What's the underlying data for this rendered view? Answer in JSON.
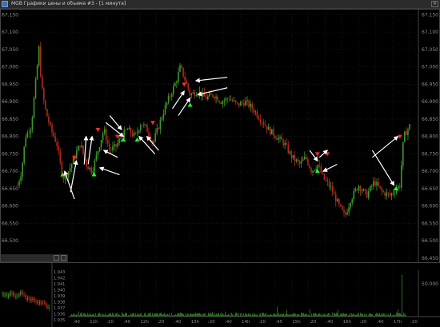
{
  "window": {
    "title": "MGB Графики цены и объема #3 - [1 минута]",
    "close_glyph": "×",
    "icon": "chart-window-icon"
  },
  "colors": {
    "background": "#000000",
    "grid": "#1e1e1e",
    "up_candle": "#3c9a2a",
    "down_candle": "#b02a1e",
    "buy_marker": "#22ff22",
    "sell_marker": "#ff2a2a",
    "annotation_arrow": "#ffffff",
    "axis_text": "#8c8c8c",
    "volume": "#3c9a2a"
  },
  "chart_data": [
    {
      "type": "candlestick",
      "title": "",
      "ylim": [
        66.45,
        67.16
      ],
      "y_ticks": [
        "67.150",
        "67.100",
        "67.050",
        "67.000",
        "66.950",
        "66.900",
        "66.850",
        "66.800",
        "66.750",
        "66.700",
        "66.650",
        "66.600",
        "66.550",
        "66.500",
        "66.450"
      ],
      "x_ticks": [
        ":40",
        "11h",
        ":20",
        ":40",
        "12h",
        ":20",
        ":40",
        "13h",
        ":20",
        ":40",
        "14h",
        ":20",
        ":45",
        "15h",
        ":20",
        ":40",
        "16h",
        ":20",
        ":40",
        "17h",
        ":20"
      ],
      "grid": true,
      "path": [
        {
          "t": 0.0,
          "p": 66.66
        },
        {
          "t": 0.01,
          "p": 66.7
        },
        {
          "t": 0.02,
          "p": 66.8
        },
        {
          "t": 0.035,
          "p": 66.83
        },
        {
          "t": 0.05,
          "p": 67.0
        },
        {
          "t": 0.055,
          "p": 67.06
        },
        {
          "t": 0.06,
          "p": 66.95
        },
        {
          "t": 0.07,
          "p": 66.88
        },
        {
          "t": 0.085,
          "p": 66.82
        },
        {
          "t": 0.1,
          "p": 66.78
        },
        {
          "t": 0.115,
          "p": 66.68
        },
        {
          "t": 0.13,
          "p": 66.7
        },
        {
          "t": 0.145,
          "p": 66.74
        },
        {
          "t": 0.16,
          "p": 66.78
        },
        {
          "t": 0.175,
          "p": 66.72
        },
        {
          "t": 0.19,
          "p": 66.7
        },
        {
          "t": 0.205,
          "p": 66.76
        },
        {
          "t": 0.22,
          "p": 66.82
        },
        {
          "t": 0.235,
          "p": 66.76
        },
        {
          "t": 0.25,
          "p": 66.77
        },
        {
          "t": 0.265,
          "p": 66.8
        },
        {
          "t": 0.28,
          "p": 66.82
        },
        {
          "t": 0.3,
          "p": 66.8
        },
        {
          "t": 0.315,
          "p": 66.84
        },
        {
          "t": 0.33,
          "p": 66.82
        },
        {
          "t": 0.345,
          "p": 66.78
        },
        {
          "t": 0.36,
          "p": 66.83
        },
        {
          "t": 0.375,
          "p": 66.88
        },
        {
          "t": 0.39,
          "p": 66.92
        },
        {
          "t": 0.405,
          "p": 66.96
        },
        {
          "t": 0.415,
          "p": 67.0
        },
        {
          "t": 0.425,
          "p": 66.97
        },
        {
          "t": 0.44,
          "p": 66.92
        },
        {
          "t": 0.46,
          "p": 66.93
        },
        {
          "t": 0.48,
          "p": 66.91
        },
        {
          "t": 0.5,
          "p": 66.92
        },
        {
          "t": 0.52,
          "p": 66.9
        },
        {
          "t": 0.54,
          "p": 66.91
        },
        {
          "t": 0.56,
          "p": 66.89
        },
        {
          "t": 0.58,
          "p": 66.9
        },
        {
          "t": 0.6,
          "p": 66.88
        },
        {
          "t": 0.62,
          "p": 66.85
        },
        {
          "t": 0.64,
          "p": 66.82
        },
        {
          "t": 0.66,
          "p": 66.8
        },
        {
          "t": 0.68,
          "p": 66.78
        },
        {
          "t": 0.7,
          "p": 66.74
        },
        {
          "t": 0.72,
          "p": 66.72
        },
        {
          "t": 0.735,
          "p": 66.74
        },
        {
          "t": 0.75,
          "p": 66.7
        },
        {
          "t": 0.765,
          "p": 66.72
        },
        {
          "t": 0.78,
          "p": 66.68
        },
        {
          "t": 0.8,
          "p": 66.65
        },
        {
          "t": 0.82,
          "p": 66.6
        },
        {
          "t": 0.835,
          "p": 66.57
        },
        {
          "t": 0.85,
          "p": 66.62
        },
        {
          "t": 0.87,
          "p": 66.66
        },
        {
          "t": 0.89,
          "p": 66.63
        },
        {
          "t": 0.91,
          "p": 66.67
        },
        {
          "t": 0.93,
          "p": 66.64
        },
        {
          "t": 0.95,
          "p": 66.63
        },
        {
          "t": 0.965,
          "p": 66.65
        },
        {
          "t": 0.975,
          "p": 66.66
        },
        {
          "t": 0.985,
          "p": 66.8
        },
        {
          "t": 1.0,
          "p": 66.83
        }
      ],
      "buy_signals": [
        {
          "t": 0.115,
          "p": 66.69
        },
        {
          "t": 0.195,
          "p": 66.69
        },
        {
          "t": 0.27,
          "p": 66.79
        },
        {
          "t": 0.305,
          "p": 66.79
        },
        {
          "t": 0.44,
          "p": 66.89
        },
        {
          "t": 0.765,
          "p": 66.7
        },
        {
          "t": 0.965,
          "p": 66.65
        }
      ],
      "sell_signals": [
        {
          "t": 0.145,
          "p": 66.74
        },
        {
          "t": 0.205,
          "p": 66.82
        },
        {
          "t": 0.255,
          "p": 66.8
        },
        {
          "t": 0.345,
          "p": 66.84
        },
        {
          "t": 0.425,
          "p": 66.95
        },
        {
          "t": 0.765,
          "p": 66.75
        },
        {
          "t": 0.79,
          "p": 66.75
        },
        {
          "t": 0.975,
          "p": 66.8
        }
      ]
    },
    {
      "type": "bar",
      "title": "",
      "ylim": [
        0,
        60000
      ],
      "y_ticks": [
        "50.000"
      ],
      "description_values": "small volume bars with occasional spikes"
    },
    {
      "type": "candlestick",
      "title": "",
      "y_ticks": [
        "1.943",
        "1.942",
        "1.941",
        "1.940",
        "1.939",
        "1.938",
        "1.937",
        "1.936",
        "1.935"
      ]
    }
  ]
}
